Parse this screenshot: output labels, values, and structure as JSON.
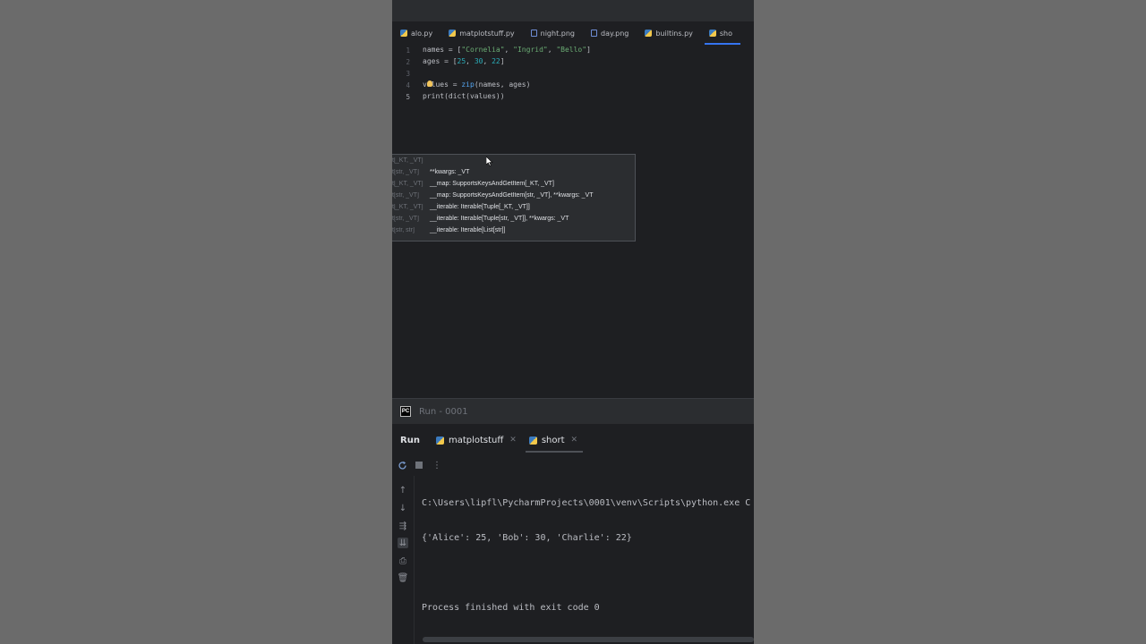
{
  "editor_tabs": [
    {
      "label": "alo.py",
      "icon": "python-file-icon"
    },
    {
      "label": "matplotstuff.py",
      "icon": "python-file-icon"
    },
    {
      "label": "night.png",
      "icon": "image-file-icon"
    },
    {
      "label": "day.png",
      "icon": "image-file-icon"
    },
    {
      "label": "builtins.py",
      "icon": "python-file-icon"
    },
    {
      "label": "sho",
      "icon": "python-file-icon"
    }
  ],
  "line_numbers": [
    "1",
    "2",
    "3",
    "4",
    "5"
  ],
  "code": {
    "l1_a": "names = [",
    "l1_s1": "\"Cornelia\"",
    "l1_c1": ", ",
    "l1_s2": "\"Ingrid\"",
    "l1_c2": ", ",
    "l1_s3": "\"Bello\"",
    "l1_b": "]",
    "l2_a": "ages = [",
    "l2_n1": "25",
    "l2_c1": ", ",
    "l2_n2": "30",
    "l2_c2": ", ",
    "l2_n3": "22",
    "l2_b": "]",
    "l4_a": "values = ",
    "l4_fn": "zip",
    "l4_b": "(names, ages)",
    "l5_a": "print(dict(values))"
  },
  "popup": {
    "rows": [
      {
        "dim": "t[_KT, _VT]",
        "text": ""
      },
      {
        "dim": "t[str, _VT]",
        "text": "**kwargs: _VT"
      },
      {
        "dim": "t[_KT, _VT]",
        "text": "__map: SupportsKeysAndGetItem[_KT, _VT]"
      },
      {
        "dim": "t[str, _VT]",
        "text": "__map: SupportsKeysAndGetItem[str, _VT], **kwargs: _VT"
      },
      {
        "dim": "t[_KT, _VT]",
        "text": "__iterable: Iterable[Tuple[_KT, _VT]]"
      },
      {
        "dim": "t[str, _VT]",
        "text": "__iterable: Iterable[Tuple[str, _VT]], **kwargs: _VT"
      },
      {
        "dim": "t[str, str]",
        "text": "__iterable: Iterable[List[str]]"
      }
    ]
  },
  "run_window": {
    "title": "Run - 0001",
    "run_label": "Run",
    "tabs": [
      {
        "label": "matplotstuff"
      },
      {
        "label": "short"
      }
    ]
  },
  "console": {
    "lines": [
      "C:\\Users\\lipfl\\PycharmProjects\\0001\\venv\\Scripts\\python.exe C",
      "{'Alice': 25, 'Bob': 30, 'Charlie': 22}",
      "",
      "Process finished with exit code 0"
    ]
  },
  "colors": {
    "accent": "#3574f0",
    "string": "#6aab73",
    "number": "#2aacb8",
    "function": "#56a8f5"
  }
}
